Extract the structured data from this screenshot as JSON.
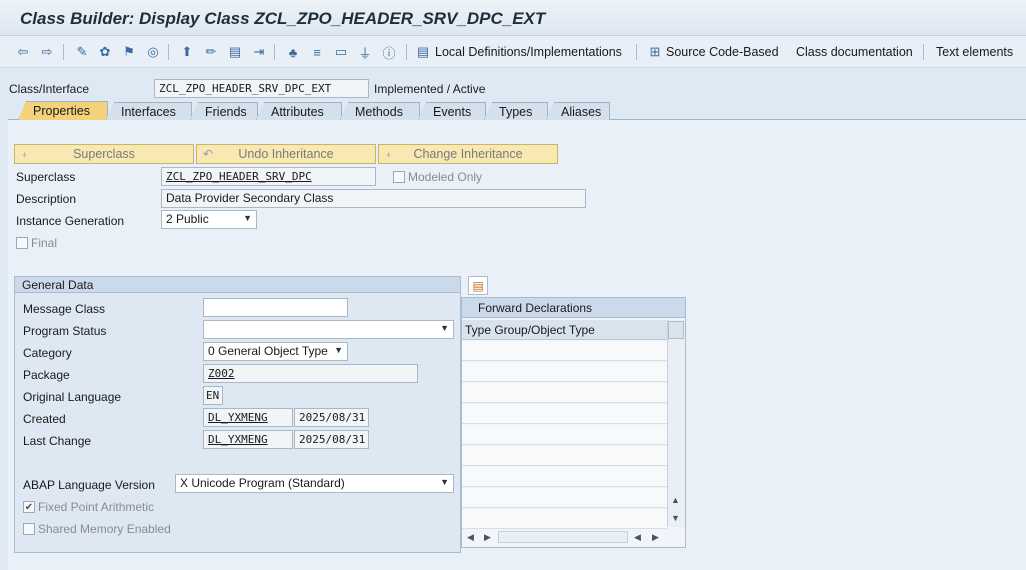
{
  "window": {
    "title": "Class Builder: Display Class ZCL_ZPO_HEADER_SRV_DPC_EXT"
  },
  "toolbar": {
    "local_defs": "Local Definitions/Implementations",
    "source_code": "Source Code-Based",
    "class_doc": "Class documentation",
    "text_elements": "Text elements"
  },
  "header": {
    "class_label": "Class/Interface",
    "class_value": "ZCL_ZPO_HEADER_SRV_DPC_EXT",
    "status": "Implemented / Active"
  },
  "tabs": [
    {
      "label": "Properties"
    },
    {
      "label": "Interfaces"
    },
    {
      "label": "Friends"
    },
    {
      "label": "Attributes"
    },
    {
      "label": "Methods"
    },
    {
      "label": "Events"
    },
    {
      "label": "Types"
    },
    {
      "label": "Aliases"
    }
  ],
  "buttons": {
    "superclass": "Superclass",
    "undo": "Undo Inheritance",
    "change": "Change Inheritance"
  },
  "props": {
    "superclass_label": "Superclass",
    "superclass_value": "ZCL_ZPO_HEADER_SRV_DPC",
    "modeled_only": "Modeled Only",
    "description_label": "Description",
    "description_value": "Data Provider Secondary Class",
    "inst_gen_label": "Instance Generation",
    "inst_gen_value": "2 Public",
    "final_label": "Final"
  },
  "general": {
    "title": "General Data",
    "message_class_label": "Message Class",
    "message_class_value": "",
    "program_status_label": "Program Status",
    "program_status_value": "",
    "category_label": "Category",
    "category_value": "0 General Object Type",
    "package_label": "Package",
    "package_value": "Z002",
    "orig_lang_label": "Original Language",
    "orig_lang_value": "EN",
    "created_label": "Created",
    "created_user": "DL_YXMENG",
    "created_date": "2025/08/31",
    "last_change_label": "Last Change",
    "last_change_user": "DL_YXMENG",
    "last_change_date": "2025/08/31",
    "abap_version_label": "ABAP Language Version",
    "abap_version_value": "X Unicode Program (Standard)",
    "fixed_point": "Fixed Point Arithmetic",
    "shared_memory": "Shared Memory Enabled"
  },
  "forward": {
    "title": "Forward Declarations",
    "column": "Type Group/Object Type"
  },
  "colors": {
    "active_tab": "#f4d27c",
    "button_bg": "#f8e9b2",
    "panel_bg": "#dde8f2"
  }
}
